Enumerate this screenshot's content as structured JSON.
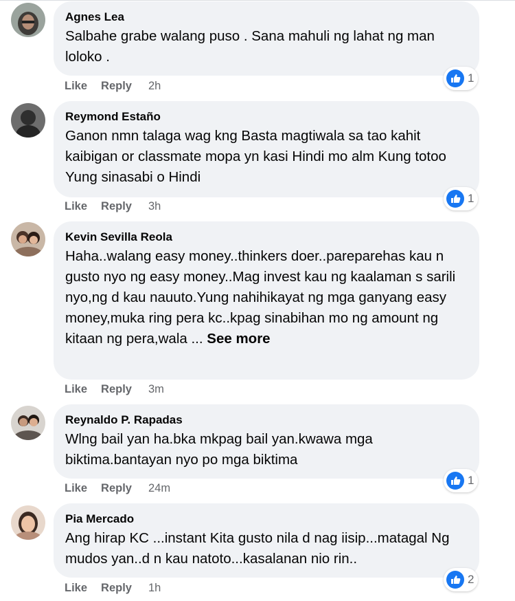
{
  "comments": [
    {
      "author": "Agnes Lea",
      "text": "Salbahe grabe walang puso . Sana mahuli ng lahat ng man loloko .",
      "like": "Like",
      "reply": "Reply",
      "time": "2h",
      "reactions": "1"
    },
    {
      "author": "Reymond Estaño",
      "text": "Ganon nmn talaga wag kng Basta magtiwala sa tao kahit kaibigan or classmate mopa yn kasi Hindi mo alm Kung totoo Yung sinasabi o Hindi",
      "like": "Like",
      "reply": "Reply",
      "time": "3h",
      "reactions": "1"
    },
    {
      "author": "Kevin Sevilla Reola",
      "text": "Haha..walang easy money..thinkers doer..pareparehas kau n gusto nyo ng easy money..Mag invest kau ng kaalaman s sarili nyo,ng d kau nauuto.Yung nahihikayat ng mga ganyang easy money,muka ring pera kc..kpag sinabihan mo ng amount ng kitaan ng pera,wala ...",
      "see_more": "See more",
      "like": "Like",
      "reply": "Reply",
      "time": "3m"
    },
    {
      "author": "Reynaldo P. Rapadas",
      "text": "Wlng bail yan ha.bka mkpag bail yan.kwawa mga biktima.bantayan nyo po mga biktima",
      "like": "Like",
      "reply": "Reply",
      "time": "24m",
      "reactions": "1"
    },
    {
      "author": "Pia Mercado",
      "text": "Ang hirap KC ...instant Kita gusto nila d nag iisip...matagal Ng mudos yan..d n kau natoto...kasalanan nio rin..",
      "like": "Like",
      "reply": "Reply",
      "time": "1h",
      "reactions": "2"
    }
  ],
  "colors": {
    "bubble": "#f0f2f5",
    "secondary_text": "#65676b",
    "like_blue": "#1877f2"
  }
}
